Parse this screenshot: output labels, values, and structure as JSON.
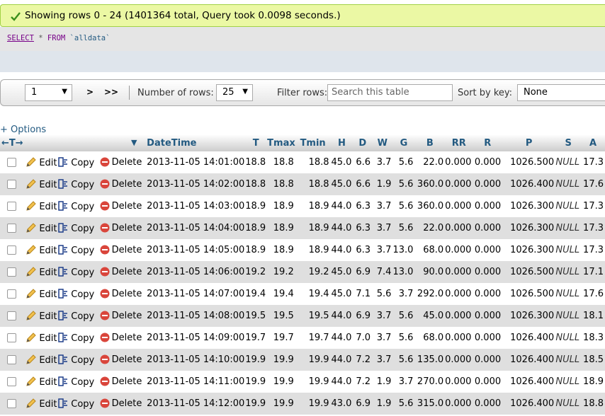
{
  "banner": {
    "message": "Showing rows 0 - 24 (1401364 total, Query took 0.0098 seconds.)"
  },
  "sql": {
    "select": "SELECT",
    "star": "*",
    "from": "FROM",
    "table": "`alldata`"
  },
  "nav": {
    "page_value": "1",
    "next_label": ">",
    "last_label": ">>",
    "num_rows_label": "Number of rows:",
    "num_rows_value": "25",
    "filter_label": "Filter rows:",
    "search_placeholder": "Search this table",
    "sort_label": "Sort by key:",
    "sort_value": "None"
  },
  "options_label": "+ Options",
  "header": {
    "arrows": "←T→",
    "sort_icon": "triangle-down-icon",
    "columns": [
      "DateTime",
      "T",
      "Tmax",
      "Tmin",
      "H",
      "D",
      "W",
      "G",
      "B",
      "RR",
      "R",
      "P",
      "S",
      "A"
    ]
  },
  "actions": {
    "edit": "Edit",
    "copy": "Copy",
    "delete": "Delete"
  },
  "icons": {
    "edit": "pencil-icon",
    "copy": "copy-icon",
    "delete": "delete-icon",
    "success": "check-icon"
  },
  "colors": {
    "link": "#235a81",
    "banner_bg": "#ebf8a4",
    "row_alt": "#dfdfdf"
  },
  "rows": [
    [
      "2013-11-05 14:01:00",
      "18.8",
      "18.8",
      "18.8",
      "45.0",
      "6.6",
      "3.7",
      "5.6",
      "22.0",
      "0.000",
      "0.000",
      "1026.500",
      "NULL",
      "17.3"
    ],
    [
      "2013-11-05 14:02:00",
      "18.8",
      "18.8",
      "18.8",
      "45.0",
      "6.6",
      "1.9",
      "5.6",
      "360.0",
      "0.000",
      "0.000",
      "1026.400",
      "NULL",
      "17.6"
    ],
    [
      "2013-11-05 14:03:00",
      "18.9",
      "18.9",
      "18.9",
      "44.0",
      "6.3",
      "3.7",
      "5.6",
      "360.0",
      "0.000",
      "0.000",
      "1026.300",
      "NULL",
      "17.3"
    ],
    [
      "2013-11-05 14:04:00",
      "18.9",
      "18.9",
      "18.9",
      "44.0",
      "6.3",
      "3.7",
      "5.6",
      "22.0",
      "0.000",
      "0.000",
      "1026.300",
      "NULL",
      "17.3"
    ],
    [
      "2013-11-05 14:05:00",
      "18.9",
      "18.9",
      "18.9",
      "44.0",
      "6.3",
      "3.7",
      "13.0",
      "68.0",
      "0.000",
      "0.000",
      "1026.300",
      "NULL",
      "17.3"
    ],
    [
      "2013-11-05 14:06:00",
      "19.2",
      "19.2",
      "19.2",
      "45.0",
      "6.9",
      "7.4",
      "13.0",
      "90.0",
      "0.000",
      "0.000",
      "1026.500",
      "NULL",
      "17.1"
    ],
    [
      "2013-11-05 14:07:00",
      "19.4",
      "19.4",
      "19.4",
      "45.0",
      "7.1",
      "5.6",
      "3.7",
      "292.0",
      "0.000",
      "0.000",
      "1026.500",
      "NULL",
      "17.6"
    ],
    [
      "2013-11-05 14:08:00",
      "19.5",
      "19.5",
      "19.5",
      "44.0",
      "6.9",
      "3.7",
      "5.6",
      "45.0",
      "0.000",
      "0.000",
      "1026.300",
      "NULL",
      "18.1"
    ],
    [
      "2013-11-05 14:09:00",
      "19.7",
      "19.7",
      "19.7",
      "44.0",
      "7.0",
      "3.7",
      "5.6",
      "68.0",
      "0.000",
      "0.000",
      "1026.400",
      "NULL",
      "18.3"
    ],
    [
      "2013-11-05 14:10:00",
      "19.9",
      "19.9",
      "19.9",
      "44.0",
      "7.2",
      "3.7",
      "5.6",
      "135.0",
      "0.000",
      "0.000",
      "1026.400",
      "NULL",
      "18.5"
    ],
    [
      "2013-11-05 14:11:00",
      "19.9",
      "19.9",
      "19.9",
      "44.0",
      "7.2",
      "1.9",
      "3.7",
      "270.0",
      "0.000",
      "0.000",
      "1026.400",
      "NULL",
      "18.9"
    ],
    [
      "2013-11-05 14:12:00",
      "19.9",
      "19.9",
      "19.9",
      "43.0",
      "6.9",
      "1.9",
      "5.6",
      "315.0",
      "0.000",
      "0.000",
      "1026.400",
      "NULL",
      "18.8"
    ]
  ]
}
